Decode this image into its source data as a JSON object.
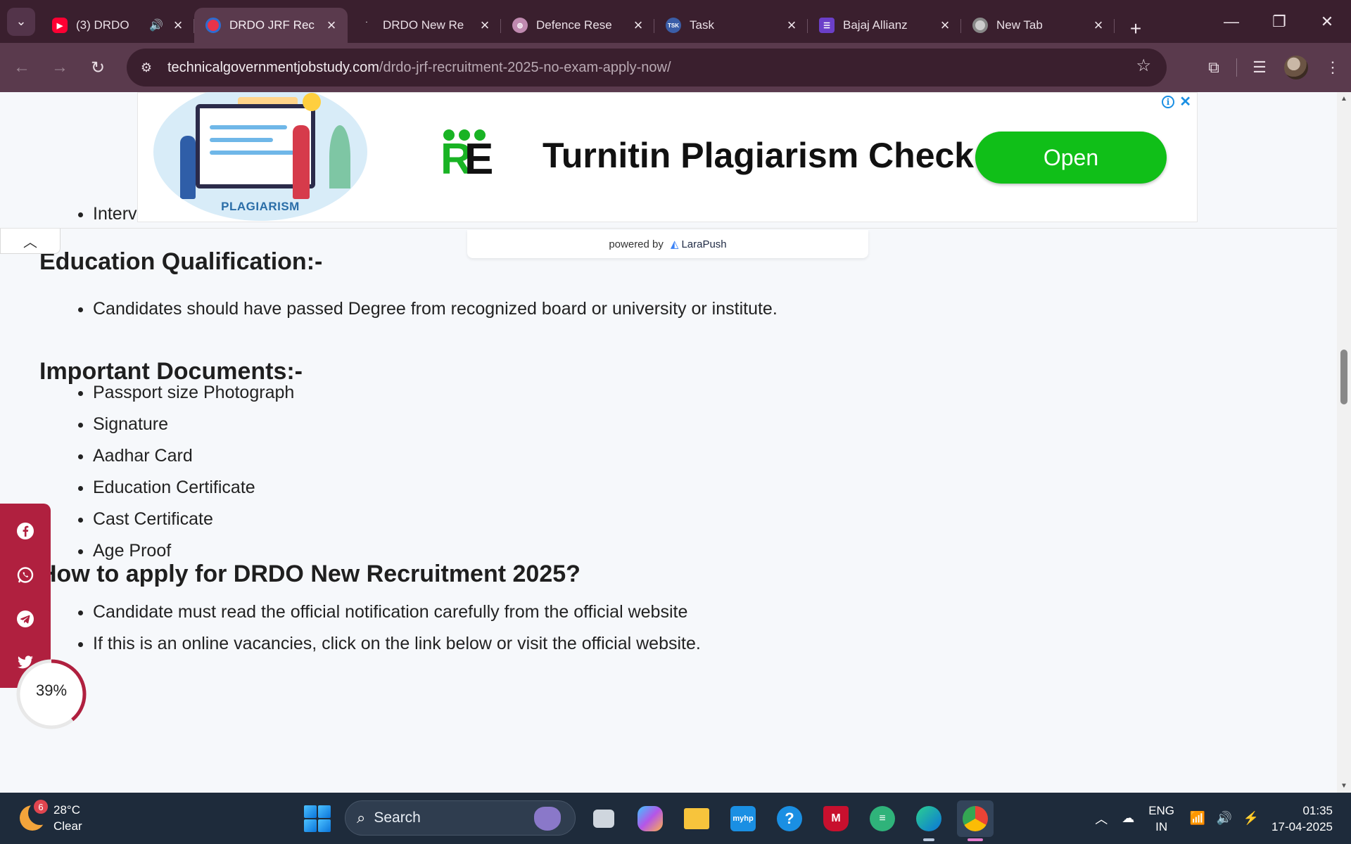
{
  "browser": {
    "tabs": [
      {
        "title": "(3) DRDO",
        "favicon_color": "#ff0033",
        "audio": true
      },
      {
        "title": "DRDO JRF Rec",
        "favicon_color": "#e8334a",
        "active": true
      },
      {
        "title": "DRDO New Re",
        "favicon_color": "#5a3a4d"
      },
      {
        "title": "Defence Rese",
        "favicon_color": "#c08ab0"
      },
      {
        "title": "Task",
        "favicon_color": "#3b5ea8"
      },
      {
        "title": "Bajaj Allianz",
        "favicon_color": "#6b3fc9"
      },
      {
        "title": "New Tab",
        "favicon_color": "#cccccc"
      }
    ],
    "url_host": "technicalgovernmentjobstudy.com",
    "url_path": "/drdo-jrf-recruitment-2025-no-exam-apply-now/",
    "theme_color": "#3a1f2e"
  },
  "ad": {
    "illustration_caption": "PLAGIARISM",
    "logo_text": "RE",
    "headline": "Turnitin Plagiarism Check",
    "cta": "Open",
    "info_glyph": "i",
    "close_glyph": "✕",
    "cta_color": "#10bf18"
  },
  "powered_by": {
    "prefix": "powered by",
    "brand": "LaraPush"
  },
  "article": {
    "selection_process_tail": [
      "Interview"
    ],
    "education_heading": "Education Qualification:-",
    "education_items": [
      "Candidates should have passed Degree from recognized board or university or institute."
    ],
    "documents_heading": "Important Documents:-",
    "documents_items": [
      "Passport size Photograph",
      "Signature",
      "Aadhar Card",
      "Education Certificate",
      "Cast Certificate",
      "Age Proof"
    ],
    "apply_heading": "How to apply for DRDO New Recruitment 2025?",
    "apply_items": [
      "Candidate must read the official notification carefully from the official website",
      "If this is an online vacancies, click on the link below or visit the official website."
    ]
  },
  "social": {
    "icons": [
      "facebook-icon",
      "whatsapp-icon",
      "telegram-icon",
      "twitter-icon"
    ],
    "color": "#b0203f"
  },
  "reading_progress": {
    "value": 0.39,
    "label": "39%"
  },
  "taskbar": {
    "weather_badge": "6",
    "temperature": "28°C",
    "condition": "Clear",
    "search_label": "Search",
    "lang_line1": "ENG",
    "lang_line2": "IN",
    "time": "01:35",
    "date": "17-04-2025"
  }
}
